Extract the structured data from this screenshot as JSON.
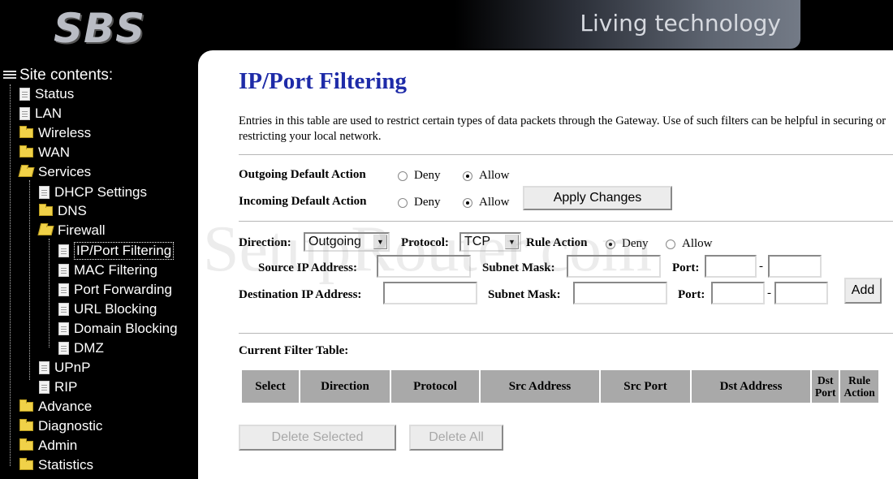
{
  "header": {
    "logo": "SBS",
    "tagline": "Living technology"
  },
  "sidebar": {
    "root": "Site contents:",
    "items": {
      "status": "Status",
      "lan": "LAN",
      "wireless": "Wireless",
      "wan": "WAN",
      "services": "Services",
      "dhcp": "DHCP Settings",
      "dns": "DNS",
      "firewall": "Firewall",
      "ip_port_filtering": "IP/Port Filtering",
      "mac_filtering": "MAC Filtering",
      "port_forwarding": "Port Forwarding",
      "url_blocking": "URL Blocking",
      "domain_blocking": "Domain Blocking",
      "dmz": "DMZ",
      "upnp": "UPnP",
      "rip": "RIP",
      "advance": "Advance",
      "diagnostic": "Diagnostic",
      "admin": "Admin",
      "statistics": "Statistics"
    }
  },
  "page": {
    "title": "IP/Port Filtering",
    "description": "Entries in this table are used to restrict certain types of data packets through the Gateway. Use of such filters can be helpful in securing or restricting your local network."
  },
  "defaults": {
    "outgoing_label": "Outgoing Default Action",
    "incoming_label": "Incoming Default Action",
    "deny": "Deny",
    "allow": "Allow",
    "outgoing_selected": "Allow",
    "incoming_selected": "Allow",
    "apply_button": "Apply Changes"
  },
  "rule": {
    "direction_label": "Direction:",
    "direction_value": "Outgoing",
    "protocol_label": "Protocol:",
    "protocol_value": "TCP",
    "rule_action_label": "Rule Action",
    "deny": "Deny",
    "allow": "Allow",
    "rule_action_selected": "Deny",
    "source_ip_label": "Source IP Address:",
    "dest_ip_label": "Destination IP Address:",
    "subnet_mask_label": "Subnet Mask:",
    "port_label": "Port:",
    "port_sep": "-",
    "add_button": "Add"
  },
  "table": {
    "title": "Current Filter Table:",
    "columns": {
      "select": "Select",
      "direction": "Direction",
      "protocol": "Protocol",
      "src_address": "Src Address",
      "src_port": "Src Port",
      "dst_address": "Dst Address",
      "dst_port_1": "Dst",
      "dst_port_2": "Port",
      "rule_action_1": "Rule",
      "rule_action_2": "Action"
    },
    "delete_selected": "Delete Selected",
    "delete_all": "Delete All"
  },
  "watermark": "SetupRouter.com"
}
